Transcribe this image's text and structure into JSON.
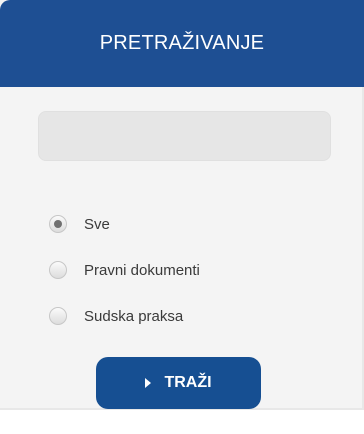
{
  "header": {
    "title": "PRETRAŽIVANJE"
  },
  "search": {
    "value": "",
    "placeholder": ""
  },
  "radios": [
    {
      "label": "Sve",
      "checked": true
    },
    {
      "label": "Pravni dokumenti",
      "checked": false
    },
    {
      "label": "Sudska praksa",
      "checked": false
    }
  ],
  "button": {
    "label": "TRAŽI",
    "icon": "play-arrow-icon"
  },
  "colors": {
    "primary": "#1e4f93",
    "panel_bg": "#f4f4f4",
    "input_bg": "#e6e6e6"
  }
}
